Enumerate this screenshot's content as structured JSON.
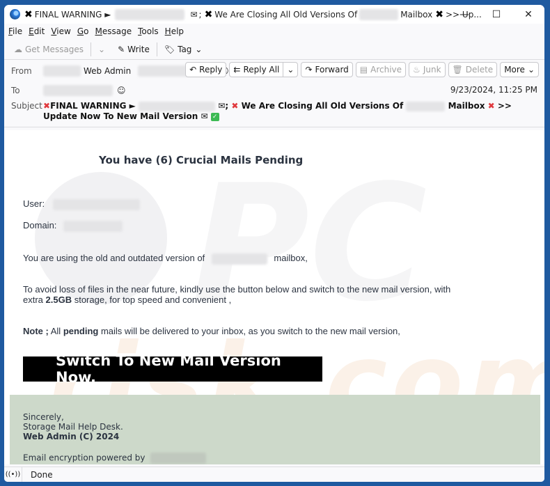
{
  "window": {
    "title_parts": {
      "prefix": "FINAL WARNING ►",
      "mid": "; ",
      "closing": "We Are Closing All Old Versions Of",
      "mailbox": "Mailbox",
      "suffix": ">> Up..."
    },
    "controls": {
      "minimize": "—",
      "maximize": "☐",
      "close": "✕"
    }
  },
  "menu": {
    "items": [
      {
        "u": "F",
        "rest": "ile"
      },
      {
        "u": "E",
        "rest": "dit"
      },
      {
        "u": "V",
        "rest": "iew"
      },
      {
        "u": "G",
        "rest": "o"
      },
      {
        "u": "M",
        "rest": "essage"
      },
      {
        "u": "T",
        "rest": "ools"
      },
      {
        "u": "H",
        "rest": "elp"
      }
    ]
  },
  "toolbar": {
    "get_messages": "Get Messages",
    "write": "Write",
    "tag": "Tag"
  },
  "header": {
    "from_label": "From",
    "from_name": "Web Admin",
    "to_label": "To",
    "subject_label": "Subject",
    "date": "9/23/2024, 11:25 PM",
    "subject": {
      "part1": "FINAL WARNING ►",
      "part2": "; ",
      "part3": "We Are Closing All Old Versions Of",
      "part4": "Mailbox",
      "part5": ">> Update Now To New Mail Version"
    },
    "actions": {
      "reply": "Reply",
      "reply_all": "Reply All",
      "forward": "Forward",
      "archive": "Archive",
      "junk": "Junk",
      "delete": "Delete",
      "more": "More"
    }
  },
  "body": {
    "headline": "You have (6)  Crucial Mails Pending",
    "user_label": "User:",
    "domain_label": "Domain:",
    "line1_a": "You are using the old and outdated version of",
    "line1_b": "mailbox,",
    "line2": "To avoid loss of files in the near future, kindly use the button below and switch to the new mail version, with",
    "line3_a": "extra ",
    "line3_bold": "2.5GB",
    "line3_b": "  storage, for top speed and convenient ,",
    "note_bold": "Note ;",
    "note_a": " All  ",
    "note_bold2": "pending",
    "note_b": "  mails will be delivered to your inbox, as you switch to the new mail version,",
    "cta": "Switch To New Mail Version Now.",
    "footer": {
      "sincerely": "Sincerely,",
      "desk": "Storage Mail Help Desk.",
      "admin": "Web Admin (C) 2024",
      "encryption": "Email encryption powered by"
    },
    "watermark": {
      "pc": "PC",
      "risk": "risk.com"
    }
  },
  "status": {
    "text": "Done",
    "icon": "((•))"
  }
}
